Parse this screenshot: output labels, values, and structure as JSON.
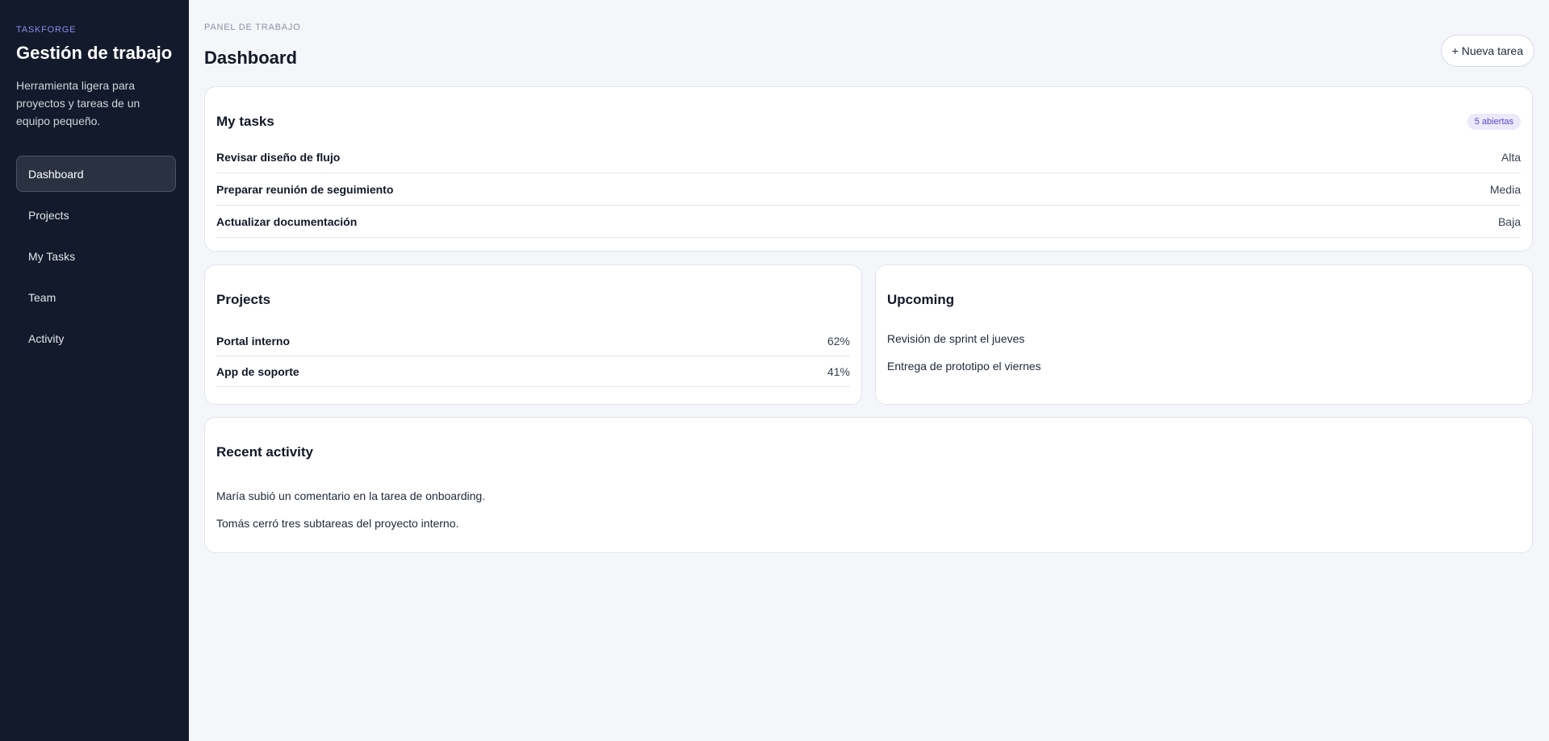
{
  "sidebar": {
    "brand_eyebrow": "TASKFORGE",
    "brand_title": "Gestión de trabajo",
    "brand_desc": "Herramienta ligera para proyectos y tareas de un equipo pequeño.",
    "items": [
      {
        "label": "Dashboard",
        "active": true
      },
      {
        "label": "Projects"
      },
      {
        "label": "My Tasks"
      },
      {
        "label": "Team"
      },
      {
        "label": "Activity"
      }
    ]
  },
  "header": {
    "eyebrow": "PANEL DE TRABAJO",
    "title": "Dashboard",
    "new_task_label": "+ Nueva tarea"
  },
  "my_tasks": {
    "title": "My tasks",
    "badge": "5 abiertas",
    "rows": [
      {
        "name": "Revisar diseño de flujo",
        "priority": "Alta"
      },
      {
        "name": "Preparar reunión de seguimiento",
        "priority": "Media"
      },
      {
        "name": "Actualizar documentación",
        "priority": "Baja"
      }
    ]
  },
  "projects": {
    "title": "Projects",
    "rows": [
      {
        "name": "Portal interno",
        "progress": "62%"
      },
      {
        "name": "App de soporte",
        "progress": "41%"
      }
    ]
  },
  "upcoming": {
    "title": "Upcoming",
    "items": [
      "Revisión de sprint el jueves",
      "Entrega de prototipo el viernes"
    ]
  },
  "activity": {
    "title": "Recent activity",
    "items": [
      "María subió un comentario en la tarea de onboarding.",
      "Tomás cerró tres subtareas del proyecto interno."
    ]
  },
  "colors": {
    "sidebar_bg": "#121a2b",
    "accent": "#8b8ff0",
    "page_bg": "#f5f6fa",
    "badge_text": "#5b4bc4",
    "badge_bg": "#ece9fb"
  }
}
